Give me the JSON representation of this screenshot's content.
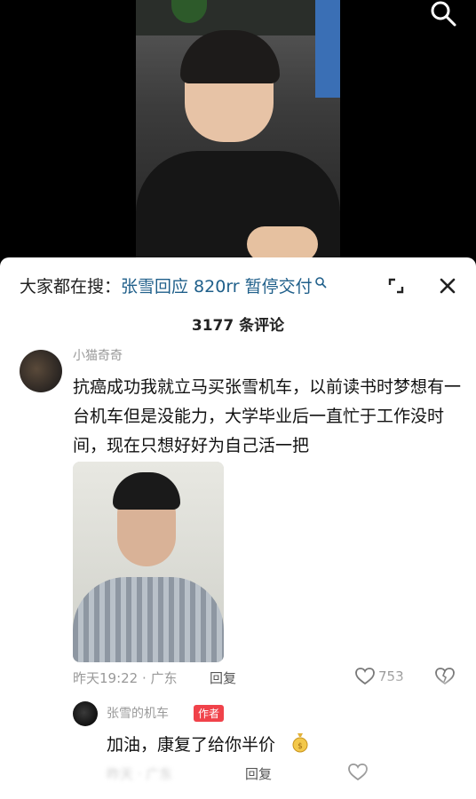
{
  "video": {
    "search_icon": "search-icon"
  },
  "search_bar": {
    "prefix": "大家都在搜：",
    "query": "张雪回应 820rr 暂停交付",
    "query_icon": "search-icon",
    "expand_icon": "expand-icon",
    "close_icon": "close-icon"
  },
  "comments_header": {
    "count_label": "3177 条评论"
  },
  "comment": {
    "username": "小猫奇奇",
    "text": "抗癌成功我就立马买张雪机车，以前读书时梦想有一台机车但是没能力，大学毕业后一直忙于工作没时间，现在只想好好为自己活一把",
    "time_location": "昨天19:22 · 广东",
    "reply_label": "回复",
    "like_count": "753"
  },
  "reply": {
    "username": "张雪的机车",
    "badge": "作者",
    "text": "加油，康复了给你半价",
    "time_location": "昨天 · 广东",
    "reply_label": "回复"
  },
  "colors": {
    "query_link": "#1f5f8a",
    "author_badge": "#f0424a",
    "meta_gray": "#999999"
  }
}
